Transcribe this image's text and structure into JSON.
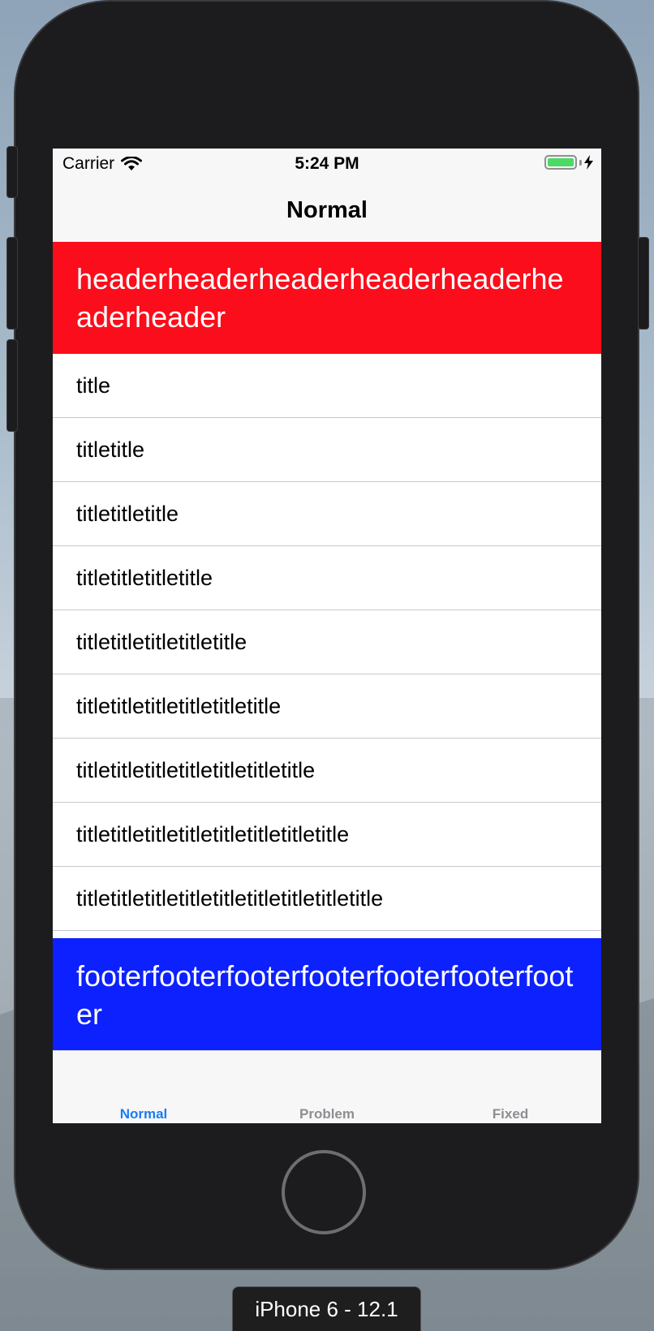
{
  "status_bar": {
    "carrier": "Carrier",
    "time": "5:24 PM"
  },
  "nav_bar": {
    "title": "Normal"
  },
  "header": {
    "text": "headerheaderheaderheaderheaderheaderheader",
    "background": "#fc0d1b"
  },
  "rows": [
    {
      "label": "title"
    },
    {
      "label": "titletitle"
    },
    {
      "label": "titletitletitle"
    },
    {
      "label": "titletitletitletitle"
    },
    {
      "label": "titletitletitletitletitle"
    },
    {
      "label": "titletitletitletitletitletitle"
    },
    {
      "label": "titletitletitletitletitletitletitle"
    },
    {
      "label": "titletitletitletitletitletitletitletitle"
    },
    {
      "label": "titletitletitletitletitletitletitletitletitle"
    }
  ],
  "footer": {
    "text": "footerfooterfooterfooterfooterfooterfooter",
    "background": "#0c21fe"
  },
  "tab_bar": {
    "tabs": [
      {
        "label": "Normal",
        "selected": true,
        "color": "#1a7cf5"
      },
      {
        "label": "Problem",
        "selected": false,
        "color": "#8e8e93"
      },
      {
        "label": "Fixed",
        "selected": false,
        "color": "#8e8e93"
      }
    ]
  },
  "device": {
    "label": "iPhone 6 - 12.1"
  }
}
